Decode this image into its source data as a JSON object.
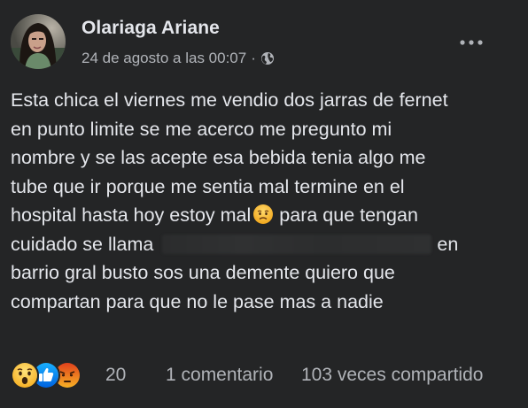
{
  "post": {
    "author": "Olariaga Ariane",
    "timestamp": "24 de agosto a las 00:07",
    "separator": "·",
    "audience_icon": "globe-icon",
    "more_icon": "ellipsis-icon",
    "text_lines": {
      "l1": "Esta chica el viernes me vendio dos jarras de fernet",
      "l2": "en punto limite se me acerco me pregunto mi",
      "l3": "nombre y se las acepte esa bebida tenia algo me",
      "l4": "tube que ir porque me sentia mal termine en el",
      "l5a": "hospital hasta hoy estoy mal",
      "l5b": "para que tengan",
      "l6a": "cuidado se llama",
      "l6b": "en",
      "l7": "barrio gral busto sos una demente quiero que",
      "l8": "compartan para que no le pase mas a nadie"
    },
    "inline_emoji": "worried-face-emoji",
    "redacted_name": "blurred-name"
  },
  "footer": {
    "reactions": [
      "wow-reaction-icon",
      "like-reaction-icon",
      "angry-reaction-icon"
    ],
    "reaction_count": "20",
    "comments": "1 comentario",
    "shares": "103 veces compartido"
  },
  "colors": {
    "background": "#242526",
    "text_primary": "#e4e6eb",
    "text_secondary": "#b0b3b8",
    "like_blue": "#1877f2",
    "angry_red": "#e9710f",
    "wow_yellow": "#f7b125"
  }
}
